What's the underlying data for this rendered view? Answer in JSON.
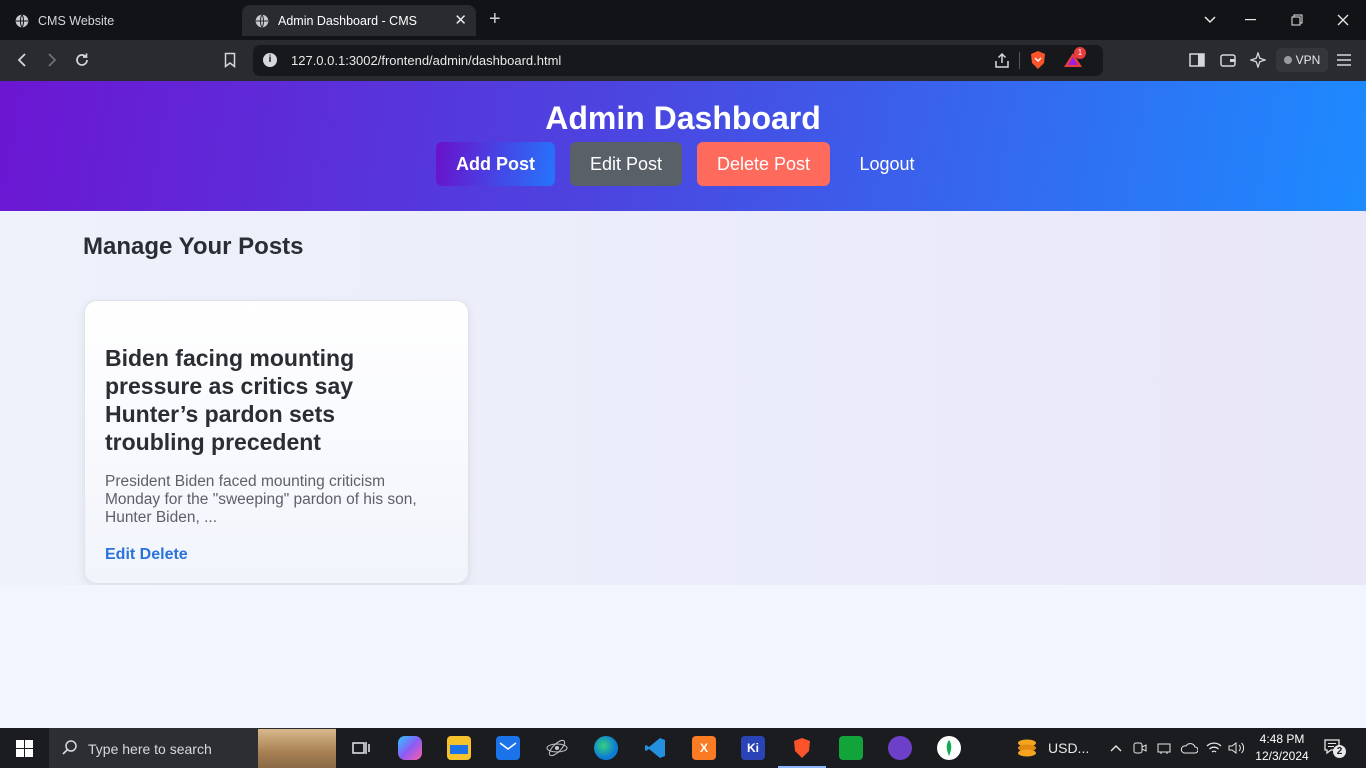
{
  "browser": {
    "tabs": [
      {
        "title": "CMS Website",
        "active": false
      },
      {
        "title": "Admin Dashboard - CMS",
        "active": true
      }
    ],
    "new_tab": "+",
    "url": "127.0.0.1:3002/frontend/admin/dashboard.html",
    "brave_badge_count": "1",
    "vpn_label": "VPN"
  },
  "header": {
    "title": "Admin Dashboard",
    "nav": {
      "add_post": "Add Post",
      "edit_post": "Edit Post",
      "delete_post": "Delete Post",
      "logout": "Logout"
    }
  },
  "main": {
    "heading": "Manage Your Posts",
    "posts": [
      {
        "title": "Biden facing mounting pressure as critics say Hunter’s pardon sets troubling precedent",
        "excerpt": "President Biden faced mounting criticism Monday for the \"sweeping\" pardon of his son, Hunter Biden, ...",
        "edit_label": "Edit",
        "delete_label": "Delete"
      }
    ]
  },
  "taskbar": {
    "search_placeholder": "Type here to search",
    "weather_label": "USD...",
    "time": "4:48 PM",
    "date": "12/3/2024",
    "notification_count": "2"
  },
  "colors": {
    "header_gradient_start": "#6c16d2",
    "header_gradient_end": "#1d8bff",
    "delete_button": "#fe6b5d",
    "edit_button": "#5a6068",
    "link": "#2a73d9"
  }
}
